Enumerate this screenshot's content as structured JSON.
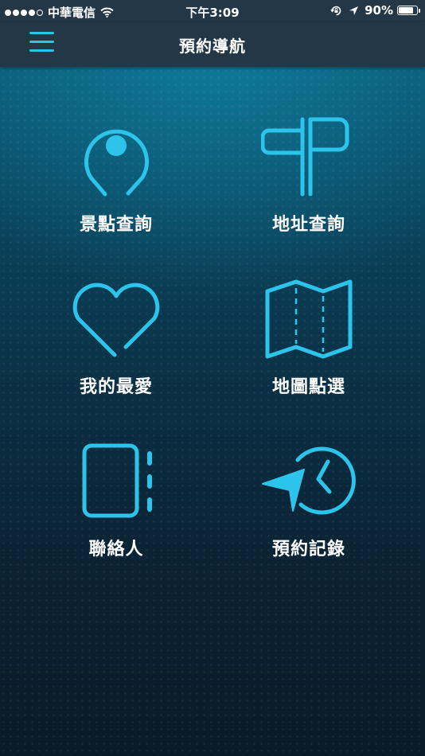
{
  "status_bar": {
    "carrier": "中華電信",
    "time": "下午3:09",
    "battery": "90%",
    "battery_level": 0.9
  },
  "nav": {
    "title": "預約導航",
    "menu_icon": "hamburger-menu-icon"
  },
  "colors": {
    "accent": "#2cc4ea",
    "bar": "#233746",
    "text": "#ffffff"
  },
  "menu_items": [
    {
      "label": "景點查詢",
      "icon": "map-pin-icon"
    },
    {
      "label": "地址查詢",
      "icon": "signpost-icon"
    },
    {
      "label": "我的最愛",
      "icon": "heart-icon"
    },
    {
      "label": "地圖點選",
      "icon": "folded-map-icon"
    },
    {
      "label": "聯絡人",
      "icon": "contacts-icon"
    },
    {
      "label": "預約記錄",
      "icon": "history-clock-icon"
    }
  ]
}
